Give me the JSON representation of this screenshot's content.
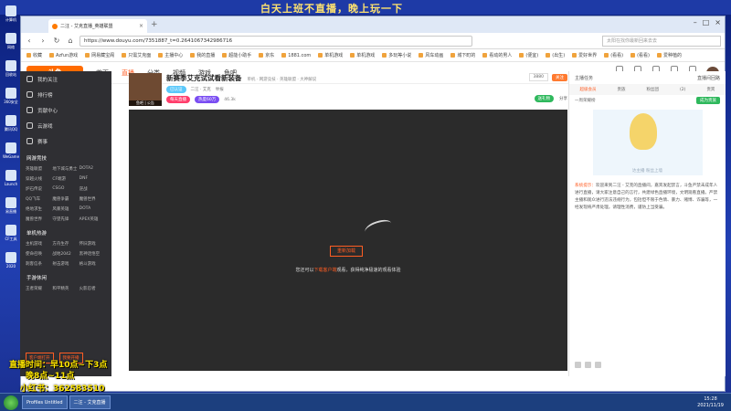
{
  "top_banner": "白天上班不直播，晚上玩一下",
  "desktop_icons": [
    {
      "label": "计算机"
    },
    {
      "label": "网络"
    },
    {
      "label": "回收站"
    },
    {
      "label": "360安全"
    },
    {
      "label": "腾讯QQ"
    },
    {
      "label": "WeGame"
    },
    {
      "label": "Launch"
    },
    {
      "label": "易直播"
    },
    {
      "label": "CF工具"
    },
    {
      "label": "2020"
    }
  ],
  "browser": {
    "tab_title": "二汪 - 艾克直播_英雄联盟",
    "url": "https://www.douyu.com/7351887_t=0.2641067342986716",
    "search_placeholder": "太阳在找你最新回来去去",
    "bookmarks": [
      "收藏",
      "Azfun游戏",
      "网易藏宝阁",
      "只需艾克面",
      "主播中心",
      "我的直播",
      "超能小助手",
      "京东",
      "1881.com",
      "单机游戏",
      "单机游戏",
      "多玩等小说",
      "风车动画",
      "城下町的",
      "看动的男人",
      "(便宜)",
      "(出生)",
      "爱好世界",
      "(看看)",
      "(看看)",
      "爱种植的"
    ]
  },
  "site": {
    "logo": "斗鱼",
    "nav": [
      "首页",
      "直播",
      "分类",
      "视频",
      "游戏",
      "鱼吧"
    ],
    "header_icons": [
      "历史",
      "关注",
      "下载",
      "开播",
      "创作"
    ]
  },
  "sidebar": {
    "items": [
      "我的关注",
      "排行榜",
      "贡献中心",
      "云游戏"
    ],
    "tabs": [
      "赛事"
    ],
    "section1": "网游竞技",
    "grid1": [
      "英雄联盟",
      "地下城与勇士",
      "DOTA2",
      "穿越火线",
      "CF端游",
      "DNF",
      "炉石传说",
      "CSGO",
      "逆战",
      "QQ飞车",
      "魔兽争霸",
      "魔兽世界",
      "绝地求生",
      "风暴英雄",
      "DOTA",
      "魔兽世界",
      "守望先锋",
      "APEX英雄"
    ],
    "section2": "单机热游",
    "grid2": [
      "主机游戏",
      "方舟生存",
      "怀旧游戏",
      "使命召唤",
      "战地2042",
      "黑神话悟空",
      "刺客信条",
      "射击游戏",
      "格斗游戏"
    ],
    "section3": "手游休闲",
    "grid3": [
      "王者荣耀",
      "和平精英",
      "火影忍者"
    ],
    "btn_open": "客户端打开",
    "btn_live": "我要开播"
  },
  "room": {
    "title": "新赛季艾克试试看新装备",
    "category": "单机 · 网游竞技 · 英雄联盟 · 大神解说",
    "level_tag": "已认证",
    "streamer": "二汪 · 艾克",
    "badge1": "每天直播",
    "badge2": "热度60万",
    "fans": "46.3k",
    "follow_count": "3880",
    "follow_btn": "关注",
    "report": "举报",
    "share": "分享",
    "pay_btn": "送礼物",
    "avatar_tag": "鱼吧 | 公告"
  },
  "player": {
    "reload_btn": "重新加载",
    "tip_prefix": "您还可以",
    "tip_highlight": "下载客户端",
    "tip_suffix": "观看，获得纯净极速的观看体验"
  },
  "chat": {
    "left": "主播任务",
    "right": "直播间回路",
    "tabs": [
      "超级会员",
      "贵族",
      "粉丝团",
      "(2)",
      "贵宾"
    ],
    "sub_left": "一周荣耀榜",
    "sub_right": "成为贵族",
    "img_caption": "达主播 粉丝上墙",
    "sys_label": "系统提示：",
    "sys_text": "欢迎来到二汪 - 艾克的直播间，嘉宾发起禁言，斗鱼严禁未成年人进行直播，请大家注意自己的言行，共建绿色直播环境，文明观看直播。严禁主播和观众进行违法违规行为，包括但不限于色情、暴力、赌博、诈骗等，一经发现将严肃处理。请理性消费，谨防上当受骗。"
  },
  "overlay": {
    "line1": "直播时间：早10点~下3点",
    "line2": "晚8点~11点",
    "line3": "小红书：362583510"
  },
  "taskbar": {
    "btn1": "Profiles Untitled",
    "btn2": "二汪 - 艾克直播",
    "time": "15:28",
    "date": "2021/11/19"
  }
}
